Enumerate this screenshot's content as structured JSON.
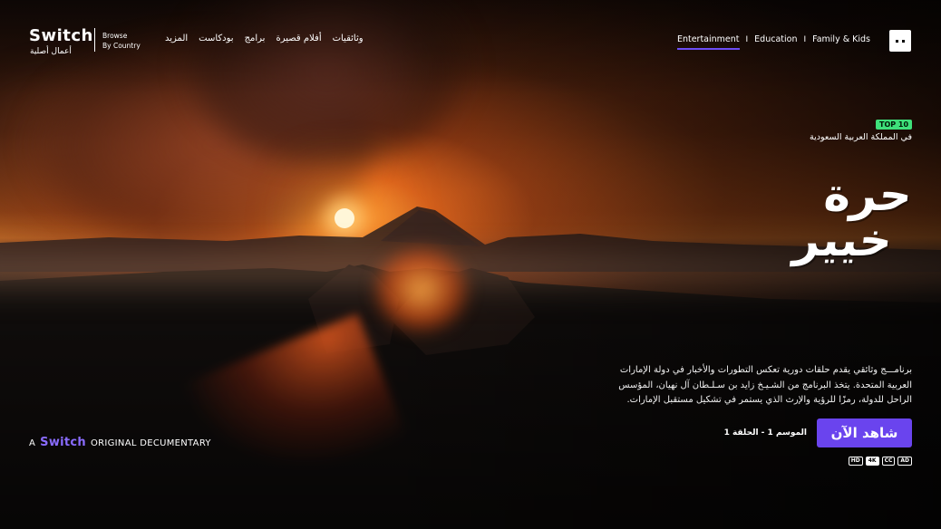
{
  "logo": {
    "word": "Switch",
    "subtitle": "أعمال أصلية"
  },
  "browse": {
    "line1": "Browse",
    "line2": "By Country"
  },
  "nav_ar": [
    "وثائقيات",
    "أفلام قصيرة",
    "برامج",
    "بودكاست",
    "المزيد"
  ],
  "nav_en": {
    "tabs": [
      "Entertainment",
      "Education",
      "Family & Kids"
    ],
    "separator": "I",
    "active": "Entertainment"
  },
  "hero": {
    "top10_badge": "TOP 10",
    "rank_text": "في المملكة العربية السعودية",
    "title_line1": "حرة",
    "title_line2": "خيير",
    "description": "برنامـــج وثائقي يقدم حلقات دورية تعكس التطورات والأخبار في دولة الإمارات العربية المتحدة. يتخذ البرنامج من الشـيـخ زايد بن سـلـطان آل نهيان، المؤسس الراحل للدولة، رمزًا للرؤية والإرث الذي يستمر في تشكيل مستقبل الإمارات.",
    "watch_label": "شاهد الآن",
    "episode_label": "الموسم 1 - الحلقة 1",
    "badges": [
      "AD",
      "CC",
      "4K",
      "HD"
    ]
  },
  "original_tag": {
    "prefix": "A",
    "brand": "Switch",
    "suffix": "ORIGINAL DECUMENTARY"
  },
  "colors": {
    "accent": "#6a44ee",
    "top10": "#3ee07a",
    "brand_text": "#8a6cff"
  }
}
